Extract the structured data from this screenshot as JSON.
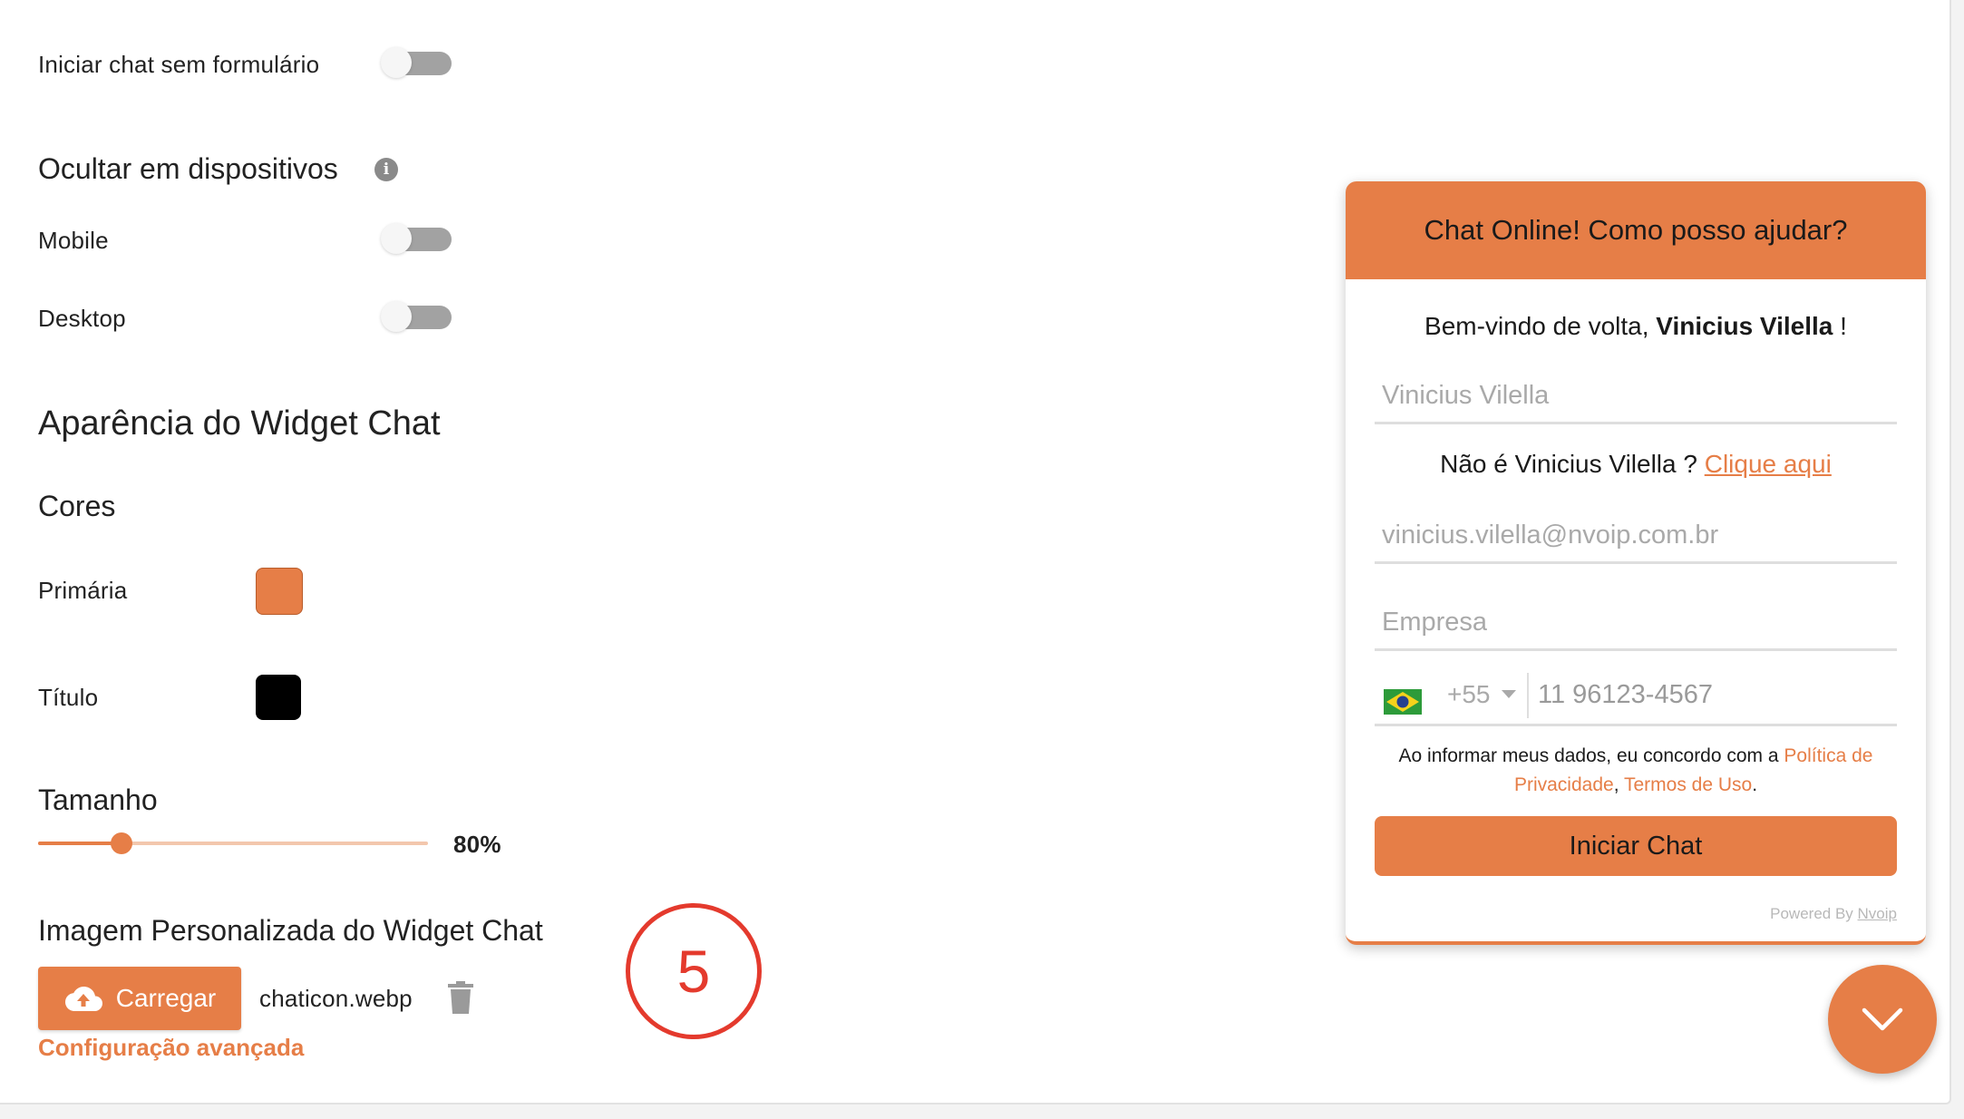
{
  "form": {
    "start_without_form_label": "Iniciar chat sem formulário",
    "hide_on_devices": {
      "heading": "Ocultar em dispositivos",
      "info_icon": "i",
      "mobile_label": "Mobile",
      "desktop_label": "Desktop"
    },
    "appearance": {
      "heading": "Aparência do Widget Chat",
      "colors_heading": "Cores",
      "primary_label": "Primária",
      "primary_color": "#e67e47",
      "title_label": "Título",
      "title_color": "#000000",
      "size_heading": "Tamanho",
      "size_value": 80,
      "size_text": "80%"
    },
    "custom_image": {
      "heading": "Imagem Personalizada do Widget Chat",
      "upload_label": "Carregar",
      "filename": "chaticon.webp",
      "advanced_link": "Configuração avançada"
    },
    "step_marker": "5"
  },
  "widget": {
    "header_title": "Chat Online! Como posso ajudar?",
    "welcome_prefix": "Bem-vindo de volta, ",
    "welcome_name": "Vinicius Vilella",
    "welcome_suffix": " !",
    "name_field": "Vinicius Vilella",
    "not_you_text": "Não é Vinicius Vilella ? ",
    "not_you_link": "Clique aqui",
    "email_field": "vinicius.vilella@nvoip.com.br",
    "company_placeholder": "Empresa",
    "phone_code": "+55",
    "phone_number": "11 96123-4567",
    "legal_prefix": "Ao informar meus dados, eu concordo com a ",
    "legal_privacy": "Política de Privacidade",
    "legal_sep": ", ",
    "legal_terms": "Termos de Uso",
    "legal_end": ".",
    "start_button": "Iniciar Chat",
    "powered_prefix": "Powered By ",
    "powered_brand": "Nvoip"
  },
  "colors": {
    "accent": "#e67e47",
    "step_marker": "#e43a2d"
  },
  "icons": {
    "upload": "cloud-upload-icon",
    "delete": "trash-icon",
    "info": "info-icon",
    "fab": "chevron-down-icon",
    "flag": "brazil-flag-icon"
  }
}
